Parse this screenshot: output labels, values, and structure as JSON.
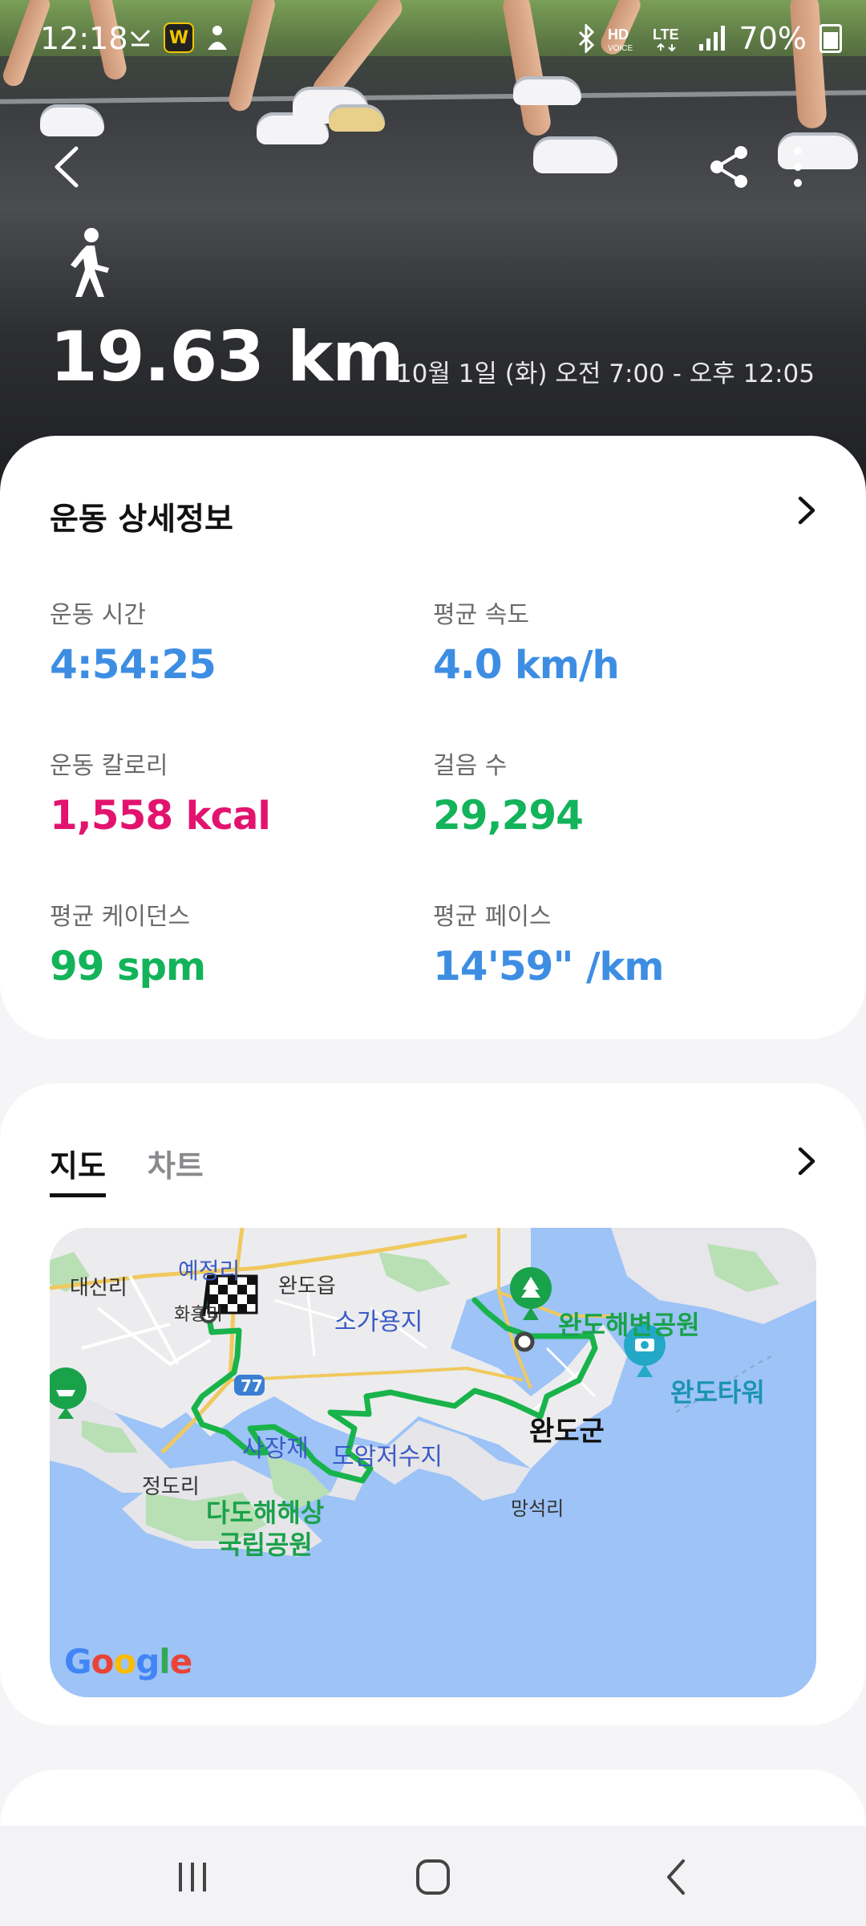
{
  "status_bar": {
    "time": "12:18",
    "battery": "70%"
  },
  "hero": {
    "distance": "19.63 km",
    "datetime": "10월 1일 (화) 오전 7:00 - 오후 12:05"
  },
  "details": {
    "title": "운동 상세정보",
    "metrics": [
      {
        "label": "운동 시간",
        "value": "4:54:25",
        "unit": "",
        "color": "#3d8ee3"
      },
      {
        "label": "평균 속도",
        "value": "4.0",
        "unit": "km/h",
        "color": "#3d8ee3"
      },
      {
        "label": "운동 칼로리",
        "value": "1,558",
        "unit": "kcal",
        "color": "#e2136e"
      },
      {
        "label": "걸음 수",
        "value": "29,294",
        "unit": "",
        "color": "#13b35a"
      },
      {
        "label": "평균 케이던스",
        "value": "99",
        "unit": "spm",
        "color": "#13b35a"
      },
      {
        "label": "평균 페이스",
        "value": "14'59\"",
        "unit": "/km",
        "color": "#3d8ee3"
      }
    ]
  },
  "map_section": {
    "tabs": [
      "지도",
      "차트"
    ],
    "labels": {
      "daesinri": "대신리",
      "yejeongri": "예정리",
      "wandoeup": "완도읍",
      "sogayongji": "소가용지",
      "wandobeach": "완도해변공원",
      "wandotower": "완도타워",
      "route77": "77",
      "sajangje": "사장제",
      "doamreservoir": "도암저수지",
      "wandogun": "완도군",
      "jeongdori": "정도리",
      "dadohae1": "다도해해상",
      "dadohae2": "국립공원",
      "mangseokri": "망석리",
      "hwaheungri": "화흥리"
    },
    "google": "Google"
  },
  "colors": {
    "route": "#19b34b",
    "accent_blue": "#3d8ee3",
    "accent_pink": "#e2136e",
    "accent_green": "#13b35a"
  }
}
